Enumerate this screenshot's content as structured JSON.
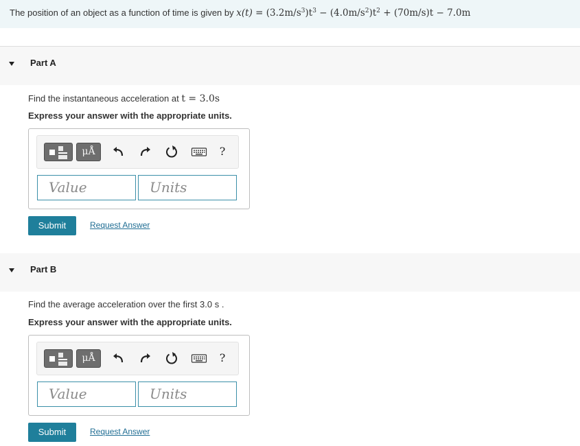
{
  "problem": {
    "text": "The position of an object as a function of time is given by",
    "lhs": "x(t) =",
    "t1_open": "(3.2m/s",
    "t1_exp": "3",
    "t1_close": ")t",
    "t1_texp": "3",
    "minus1": "−",
    "t2_open": "(4.0m/s",
    "t2_exp": "2",
    "t2_close": ")t",
    "t2_texp": "2",
    "plus": "+",
    "t3": "(70m/s)t",
    "minus2": "−",
    "t4": "7.0m"
  },
  "parts": [
    {
      "title": "Part A",
      "question_text": "Find the instantaneous acceleration at",
      "question_math": "t = 3.0s",
      "question_suffix": "",
      "instruction": "Express your answer with the appropriate units.",
      "toolbar_mu": "μÅ",
      "toolbar_help": "?",
      "value_placeholder": "Value",
      "units_placeholder": "Units",
      "submit_label": "Submit",
      "request_label": "Request Answer"
    },
    {
      "title": "Part B",
      "question_text": "Find the average acceleration over the first 3.0 s",
      "question_math": "",
      "question_suffix": ".",
      "instruction": "Express your answer with the appropriate units.",
      "toolbar_mu": "μÅ",
      "toolbar_help": "?",
      "value_placeholder": "Value",
      "units_placeholder": "Units",
      "submit_label": "Submit",
      "request_label": "Request Answer"
    }
  ],
  "icons": {
    "template": "fraction-template-icon",
    "units": "units-mu-angstrom-icon",
    "undo": "undo-arrow-icon",
    "redo": "redo-arrow-icon",
    "reset": "reset-icon",
    "keyboard": "keyboard-icon",
    "help": "help-icon"
  },
  "colors": {
    "problem_bg": "#eef6f8",
    "header_bg": "#f7f7f7",
    "accent": "#1f7f9b",
    "link": "#1f6d93",
    "field_border": "#3a8fa8"
  }
}
